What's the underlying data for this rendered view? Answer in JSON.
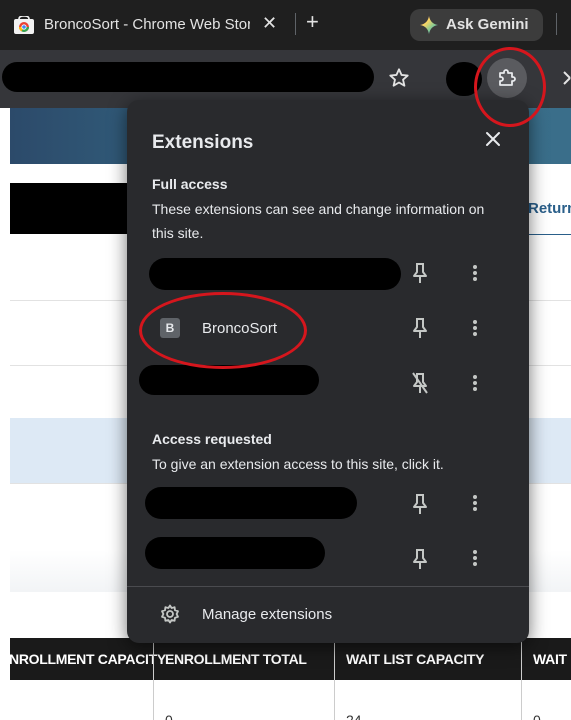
{
  "tab": {
    "title": "BroncoSort - Chrome Web Store",
    "close_glyph": "✕",
    "favicon": "chrome-web-store-icon"
  },
  "tabbar": {
    "new_tab_glyph": "+",
    "gemini_label": "Ask Gemini"
  },
  "toolbar": {
    "icons": [
      "star-icon",
      "extensions-puzzle-icon",
      "kebab-menu-icon"
    ]
  },
  "page": {
    "return_link": "Return To",
    "table_headers": [
      "ENROLLMENT CAPACITY",
      "ENROLLMENT TOTAL",
      "WAIT LIST CAPACITY",
      "WAIT"
    ],
    "first_row": [
      "",
      "0",
      "24",
      "0"
    ]
  },
  "popup": {
    "title": "Extensions",
    "full_access": {
      "heading": "Full access",
      "description": "These extensions can see and change information on this site."
    },
    "access_requested": {
      "heading": "Access requested",
      "description": "To give an extension access to this site, click it."
    },
    "extension": {
      "badge": "B",
      "name": "BroncoSort"
    },
    "manage_label": "Manage extensions"
  },
  "colors": {
    "popup_bg": "#292a2d",
    "annotation": "#d5161d",
    "table_header_bg": "#1a1a1a",
    "link": "#2a5f8a"
  }
}
